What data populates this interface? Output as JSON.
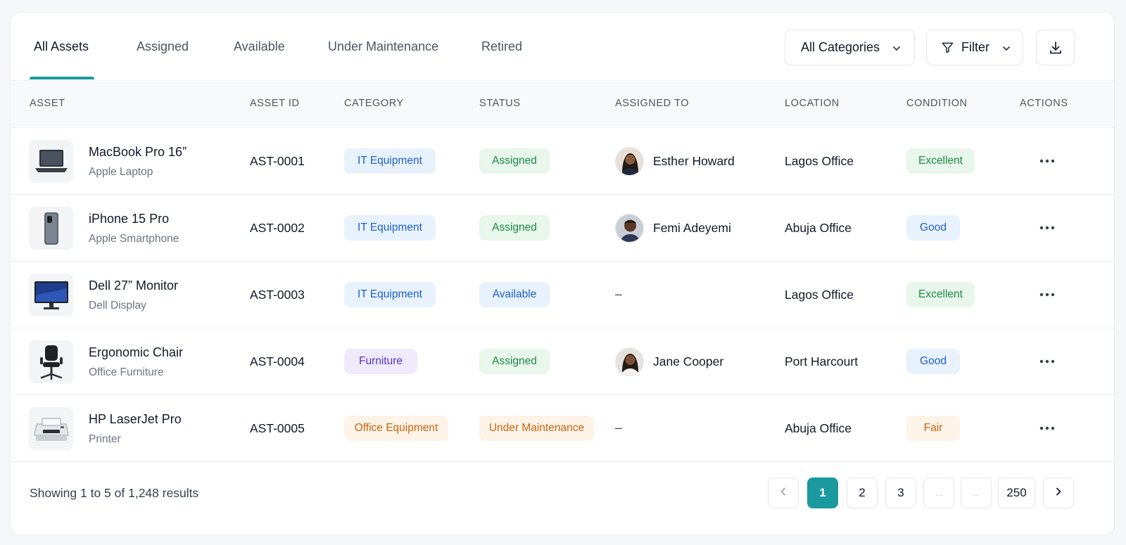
{
  "tabs": [
    {
      "label": "All Assets"
    },
    {
      "label": "Assigned"
    },
    {
      "label": "Available"
    },
    {
      "label": "Under Maintenance"
    },
    {
      "label": "Retired"
    }
  ],
  "active_tab": "All Assets",
  "controls": {
    "category_select": "All Categories",
    "filter_label": "Filter"
  },
  "columns": {
    "asset": "ASSET",
    "asset_id": "ASSET ID",
    "category": "CATEGORY",
    "status": "STATUS",
    "assigned_to": "ASSIGNED TO",
    "location": "LOCATION",
    "condition": "CONDITION",
    "actions": "ACTIONS"
  },
  "rows": [
    {
      "name": "MacBook Pro 16”",
      "sub": "Apple Laptop",
      "thumb_icon": "laptop-icon",
      "id": "AST-0001",
      "category": "IT Equipment",
      "category_color": "blue",
      "status": "Assigned",
      "status_color": "green",
      "assigned_to": "Esther Howard",
      "location": "Lagos Office",
      "condition": "Excellent",
      "condition_color": "green"
    },
    {
      "name": "iPhone 15 Pro",
      "sub": "Apple Smartphone",
      "thumb_icon": "smartphone-icon",
      "id": "AST-0002",
      "category": "IT Equipment",
      "category_color": "blue",
      "status": "Assigned",
      "status_color": "green",
      "assigned_to": "Femi Adeyemi",
      "location": "Abuja Office",
      "condition": "Good",
      "condition_color": "blue"
    },
    {
      "name": "Dell 27” Monitor",
      "sub": "Dell Display",
      "thumb_icon": "monitor-icon",
      "id": "AST-0003",
      "category": "IT Equipment",
      "category_color": "blue",
      "status": "Available",
      "status_color": "blue",
      "assigned_to": "–",
      "location": "Lagos Office",
      "condition": "Excellent",
      "condition_color": "green"
    },
    {
      "name": "Ergonomic Chair",
      "sub": "Office Furniture",
      "thumb_icon": "chair-icon",
      "id": "AST-0004",
      "category": "Furniture",
      "category_color": "purple",
      "status": "Assigned",
      "status_color": "green",
      "assigned_to": "Jane Cooper",
      "location": "Port Harcourt",
      "condition": "Good",
      "condition_color": "blue"
    },
    {
      "name": "HP LaserJet Pro",
      "sub": "Printer",
      "thumb_icon": "printer-icon",
      "id": "AST-0005",
      "category": "Office Equipment",
      "category_color": "orange",
      "status": "Under Maintenance",
      "status_color": "orange",
      "assigned_to": "–",
      "location": "Abuja Office",
      "condition": "Fair",
      "condition_color": "orange"
    }
  ],
  "footer": {
    "results_text": "Showing 1 to 5 of 1,248 results",
    "pages": [
      "1",
      "2",
      "3",
      "...",
      "...",
      "250"
    ],
    "current_page": "1"
  },
  "colors": {
    "accent": "#1a9a9e",
    "blue_bg": "#e8f2fd",
    "blue_fg": "#1d5fc8",
    "green_bg": "#e8f6ec",
    "green_fg": "#1b8a44",
    "purple_bg": "#efeafc",
    "purple_fg": "#5b2fc7",
    "orange_bg": "#fdf3e6",
    "orange_fg": "#c86412"
  }
}
